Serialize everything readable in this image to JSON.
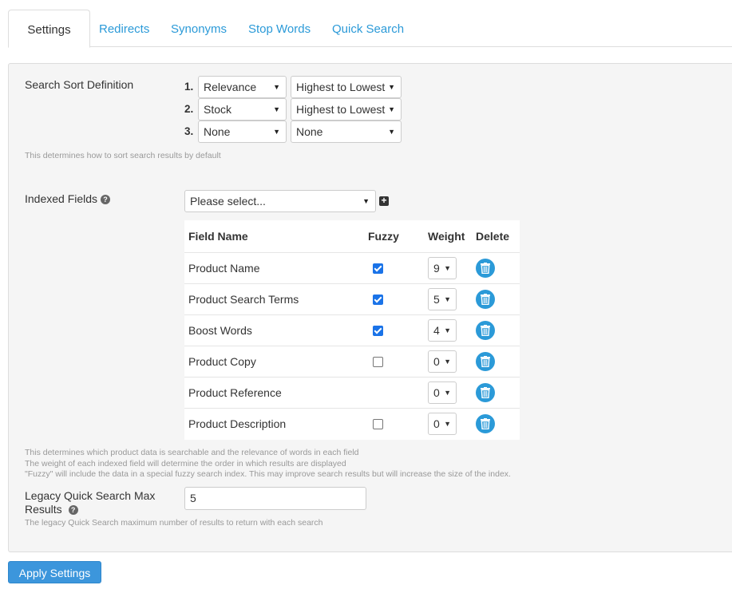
{
  "tabs": [
    {
      "label": "Settings",
      "active": true
    },
    {
      "label": "Redirects"
    },
    {
      "label": "Synonyms"
    },
    {
      "label": "Stop Words"
    },
    {
      "label": "Quick Search"
    }
  ],
  "sort": {
    "label": "Search Sort Definition",
    "rows": [
      {
        "num": "1.",
        "field": "Relevance",
        "order": "Highest to Lowest"
      },
      {
        "num": "2.",
        "field": "Stock",
        "order": "Highest to Lowest"
      },
      {
        "num": "3.",
        "field": "None",
        "order": "None"
      }
    ],
    "help": "This determines how to sort search results by default"
  },
  "indexed": {
    "label": "Indexed Fields",
    "help_icon": "?",
    "select_placeholder": "Please select...",
    "add_icon": "+",
    "columns": {
      "field": "Field Name",
      "fuzzy": "Fuzzy",
      "weight": "Weight",
      "delete": "Delete"
    },
    "rows": [
      {
        "name": "Product Name",
        "fuzzy": "checked",
        "weight": "9"
      },
      {
        "name": "Product Search Terms",
        "fuzzy": "checked",
        "weight": "5"
      },
      {
        "name": "Boost Words",
        "fuzzy": "checked",
        "weight": "4"
      },
      {
        "name": "Product Copy",
        "fuzzy": "unchecked",
        "weight": "0"
      },
      {
        "name": "Product Reference",
        "fuzzy": "none",
        "weight": "0"
      },
      {
        "name": "Product Description",
        "fuzzy": "unchecked",
        "weight": "0"
      }
    ],
    "help_lines": [
      "This determines which product data is searchable and the relevance of words in each field",
      "The weight of each indexed field will determine the order in which results are displayed",
      "\"Fuzzy\" will include the data in a special fuzzy search index. This may improve search results but will increase the size of the index."
    ]
  },
  "legacy": {
    "label_line1": "Legacy Quick Search Max",
    "label_line2": "Results",
    "help_icon": "?",
    "value": "5",
    "help": "The legacy Quick Search maximum number of results to return with each search"
  },
  "apply_label": "Apply Settings",
  "colors": {
    "accent": "#2b9ad8",
    "button": "#3c96dc",
    "panel": "#f5f5f5",
    "checkbox": "#1a73e8"
  },
  "caret_glyph": "▼"
}
